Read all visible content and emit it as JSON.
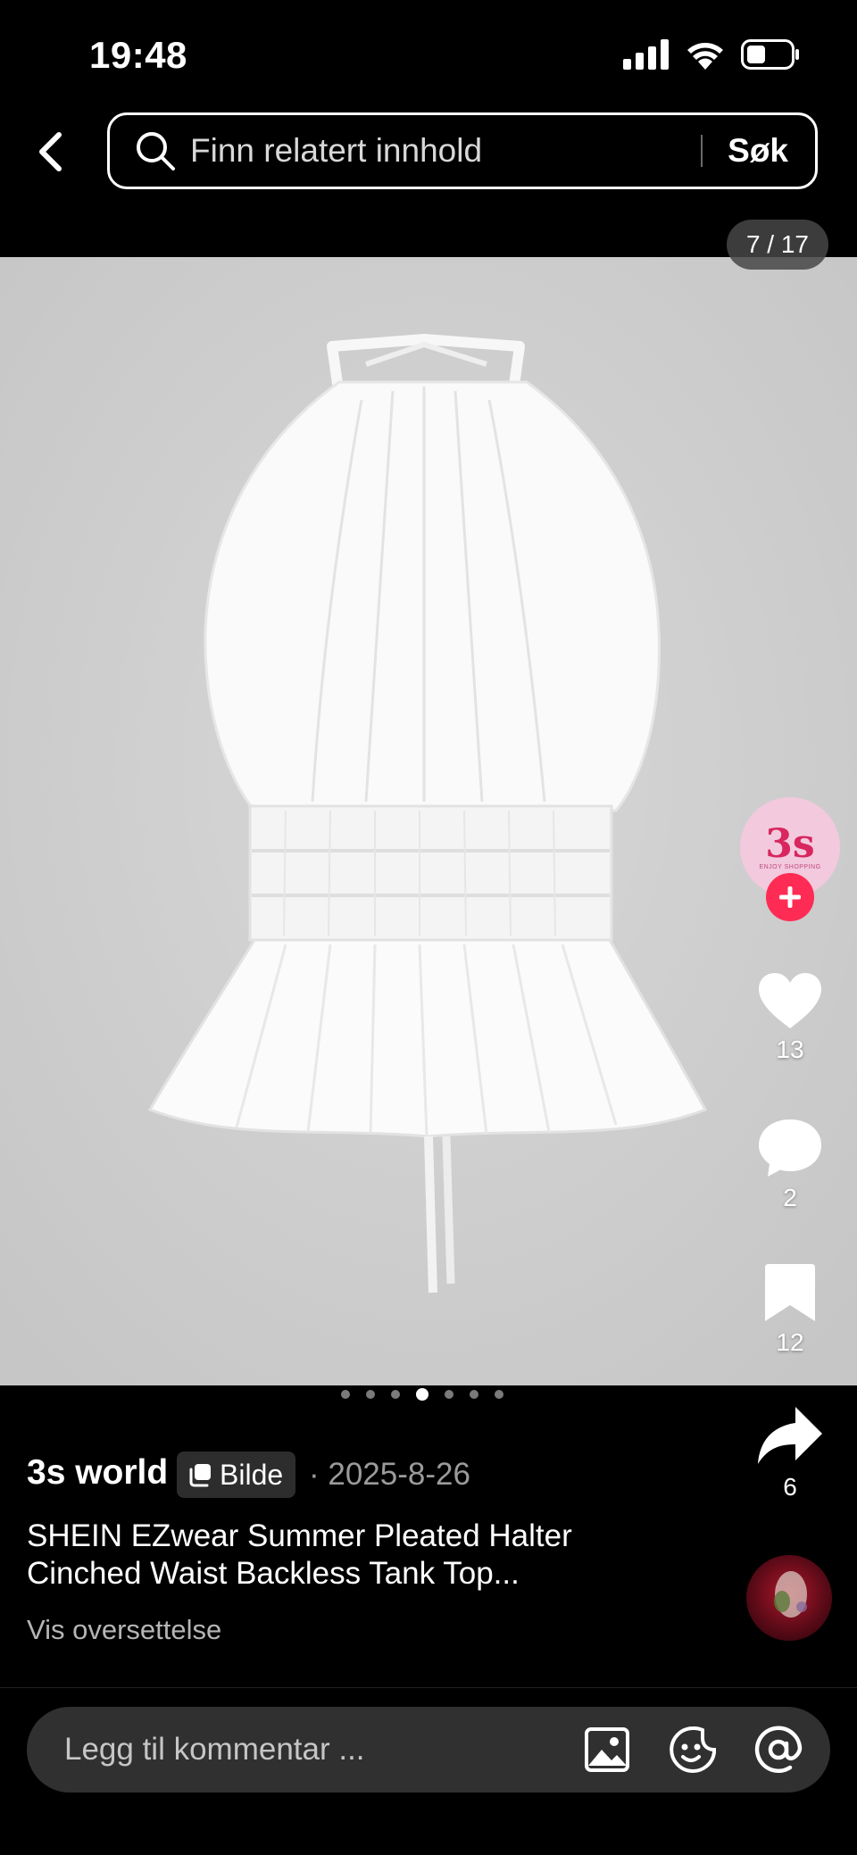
{
  "status_bar": {
    "time": "19:48"
  },
  "search": {
    "placeholder": "Finn relatert innhold",
    "submit_label": "Søk"
  },
  "gallery": {
    "counter": "7 / 17",
    "total_dots": 7,
    "active_dot": 3
  },
  "creator": {
    "avatar_text": "3s",
    "avatar_subtext": "ENJOY SHOPPING"
  },
  "actions": {
    "likes": "13",
    "comments": "2",
    "saves": "12",
    "shares": "6"
  },
  "post": {
    "author": "3s world",
    "type_label": "Bilde",
    "date": "· 2025-8-26",
    "caption_line1": "SHEIN EZwear Summer Pleated Halter",
    "caption_line2": "Cinched Waist Backless Tank Top...",
    "translate_label": "Vis oversettelse"
  },
  "comment": {
    "placeholder": "Legg til kommentar ..."
  },
  "colors": {
    "accent": "#fe2c55",
    "photo_bg": "#cfcfcf",
    "avatar_bg": "#f2c9dd"
  }
}
